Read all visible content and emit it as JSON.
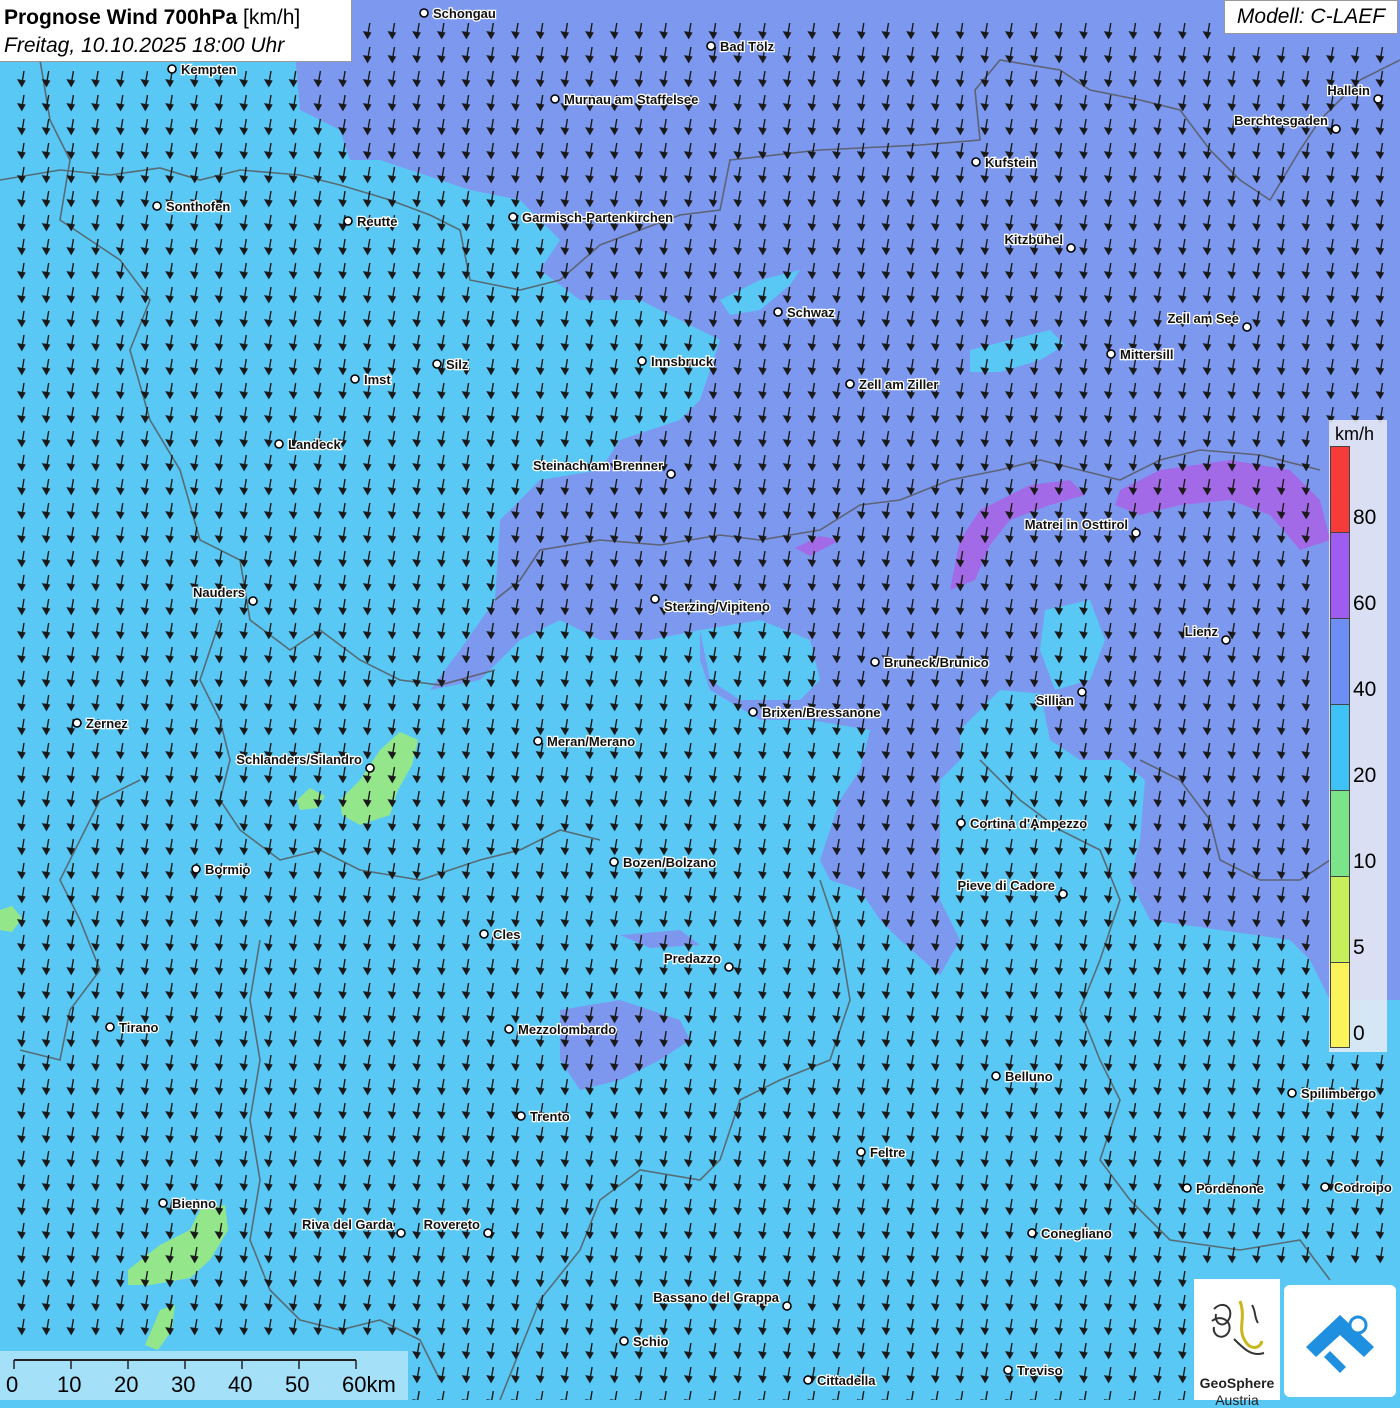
{
  "title": {
    "main": "Prognose Wind 700hPa",
    "unit": " [km/h]",
    "datetime": "Freitag, 10.10.2025 18:00 Uhr"
  },
  "model": "Modell: C-LAEF",
  "legend": {
    "unit": "km/h",
    "classes": [
      {
        "label": "80",
        "color": "#f73b3b"
      },
      {
        "label": "60",
        "color": "#9e5cf0"
      },
      {
        "label": "40",
        "color": "#6d8ef5"
      },
      {
        "label": "20",
        "color": "#3fc2f5"
      },
      {
        "label": "10",
        "color": "#7be38a"
      },
      {
        "label": "5",
        "color": "#c6ef5a"
      },
      {
        "label": "0",
        "color": "#fbf35a"
      }
    ]
  },
  "scale_bar": {
    "ticks": [
      "0",
      "10",
      "20",
      "30",
      "40",
      "50",
      "60km"
    ]
  },
  "logo": {
    "name": "GeoSphere",
    "country": "Austria"
  },
  "cities": [
    {
      "name": "Schongau"
    },
    {
      "name": "Bad Tölz"
    },
    {
      "name": "Kempten"
    },
    {
      "name": "Murnau am Staffelsee"
    },
    {
      "name": "Hallein"
    },
    {
      "name": "Berchtesgaden"
    },
    {
      "name": "Kufstein"
    },
    {
      "name": "Sonthofen"
    },
    {
      "name": "Reutte"
    },
    {
      "name": "Garmisch-Partenkirchen"
    },
    {
      "name": "Kitzbühel"
    },
    {
      "name": "Schwaz"
    },
    {
      "name": "Zell am See"
    },
    {
      "name": "Mittersill"
    },
    {
      "name": "Innsbruck"
    },
    {
      "name": "Silz"
    },
    {
      "name": "Imst"
    },
    {
      "name": "Zell am Ziller"
    },
    {
      "name": "Landeck"
    },
    {
      "name": "Steinach am Brenner"
    },
    {
      "name": "Matrei in Osttirol"
    },
    {
      "name": "Nauders"
    },
    {
      "name": "Sterzing/Vipiteno"
    },
    {
      "name": "Lienz"
    },
    {
      "name": "Bruneck/Brunico"
    },
    {
      "name": "Sillian"
    },
    {
      "name": "Zernez"
    },
    {
      "name": "Brixen/Bressanone"
    },
    {
      "name": "Meran/Merano"
    },
    {
      "name": "Schlanders/Silandro"
    },
    {
      "name": "Cortina d'Ampezzo"
    },
    {
      "name": "Bozen/Bolzano"
    },
    {
      "name": "Bormio"
    },
    {
      "name": "Pieve di Cadore"
    },
    {
      "name": "Cles"
    },
    {
      "name": "Predazzo"
    },
    {
      "name": "Tirano"
    },
    {
      "name": "Mezzolombardo"
    },
    {
      "name": "Belluno"
    },
    {
      "name": "Spilimbergo"
    },
    {
      "name": "Trento"
    },
    {
      "name": "Feltre"
    },
    {
      "name": "Pordenone"
    },
    {
      "name": "Codroipo"
    },
    {
      "name": "Bienno"
    },
    {
      "name": "Riva del Garda"
    },
    {
      "name": "Rovereto"
    },
    {
      "name": "Conegliano"
    },
    {
      "name": "Bassano del Grappa"
    },
    {
      "name": "Schio"
    },
    {
      "name": "Treviso"
    },
    {
      "name": "Cittadella"
    }
  ]
}
